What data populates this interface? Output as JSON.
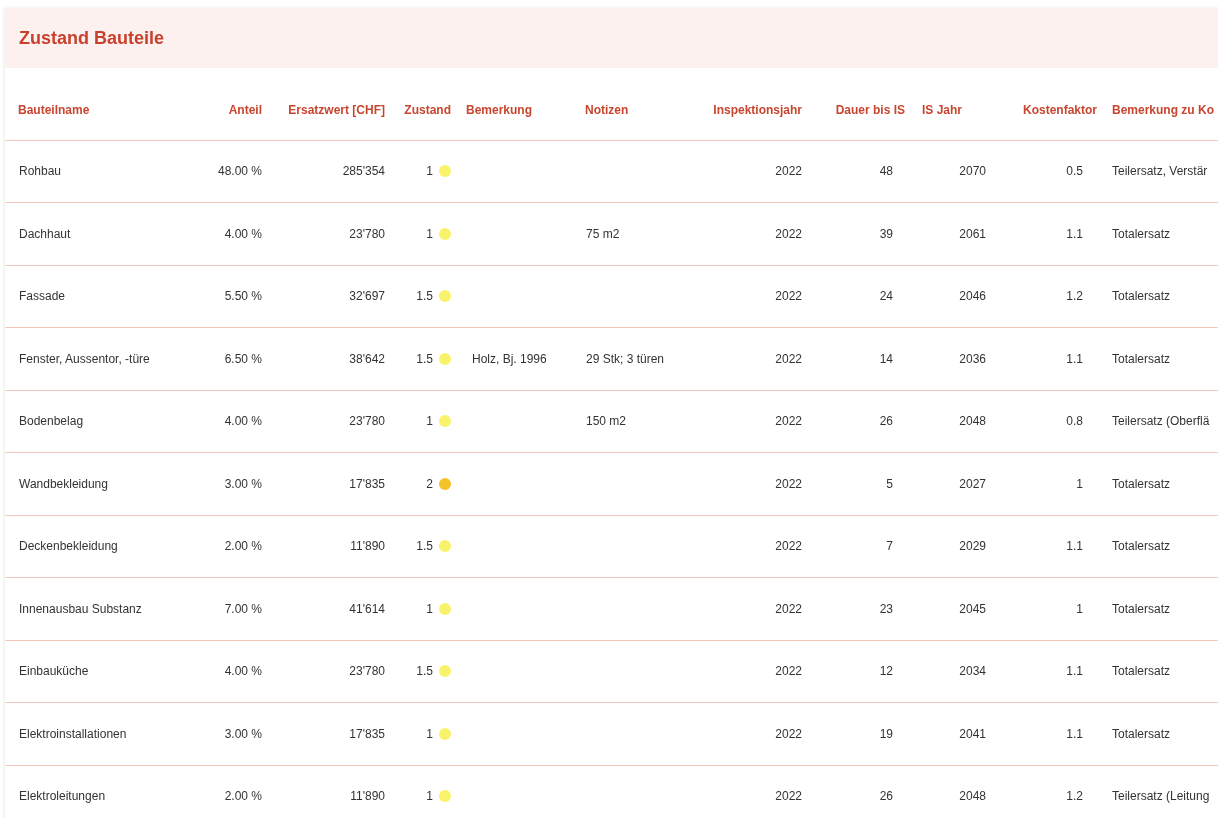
{
  "title": "Zustand Bauteile",
  "table": {
    "columns": [
      "Bauteilname",
      "Anteil",
      "Ersatzwert [CHF]",
      "Zustand",
      "Bemerkung",
      "Notizen",
      "Inspektionsjahr",
      "Dauer bis IS",
      "IS Jahr",
      "Kostenfaktor",
      "Bemerkung zu Ko"
    ],
    "rows": [
      {
        "name": "Rohbau",
        "anteil": "48.00 %",
        "ersatzwert": "285'354",
        "zustand": "1",
        "color": "#f9f36b",
        "bemerkung": "",
        "notizen": "",
        "inspektionsjahr": "2022",
        "dauer": "48",
        "is_jahr": "2070",
        "kostenfaktor": "0.5",
        "bemerkung_kosten": "Teilersatz, Verstär"
      },
      {
        "name": "Dachhaut",
        "anteil": "4.00 %",
        "ersatzwert": "23'780",
        "zustand": "1",
        "color": "#f9f36b",
        "bemerkung": "",
        "notizen": "75 m2",
        "inspektionsjahr": "2022",
        "dauer": "39",
        "is_jahr": "2061",
        "kostenfaktor": "1.1",
        "bemerkung_kosten": "Totalersatz"
      },
      {
        "name": "Fassade",
        "anteil": "5.50 %",
        "ersatzwert": "32'697",
        "zustand": "1.5",
        "color": "#f9f36b",
        "bemerkung": "",
        "notizen": "",
        "inspektionsjahr": "2022",
        "dauer": "24",
        "is_jahr": "2046",
        "kostenfaktor": "1.2",
        "bemerkung_kosten": "Totalersatz"
      },
      {
        "name": "Fenster, Aussentor, -türe",
        "anteil": "6.50 %",
        "ersatzwert": "38'642",
        "zustand": "1.5",
        "color": "#f9f36b",
        "bemerkung": "Holz, Bj. 1996",
        "notizen": "29 Stk; 3 türen",
        "inspektionsjahr": "2022",
        "dauer": "14",
        "is_jahr": "2036",
        "kostenfaktor": "1.1",
        "bemerkung_kosten": "Totalersatz"
      },
      {
        "name": "Bodenbelag",
        "anteil": "4.00 %",
        "ersatzwert": "23'780",
        "zustand": "1",
        "color": "#f9f36b",
        "bemerkung": "",
        "notizen": "150 m2",
        "inspektionsjahr": "2022",
        "dauer": "26",
        "is_jahr": "2048",
        "kostenfaktor": "0.8",
        "bemerkung_kosten": "Teilersatz (Oberflä"
      },
      {
        "name": "Wandbekleidung",
        "anteil": "3.00 %",
        "ersatzwert": "17'835",
        "zustand": "2",
        "color": "#f6c22a",
        "bemerkung": "",
        "notizen": "",
        "inspektionsjahr": "2022",
        "dauer": "5",
        "is_jahr": "2027",
        "kostenfaktor": "1",
        "bemerkung_kosten": "Totalersatz"
      },
      {
        "name": "Deckenbekleidung",
        "anteil": "2.00 %",
        "ersatzwert": "11'890",
        "zustand": "1.5",
        "color": "#f9f36b",
        "bemerkung": "",
        "notizen": "",
        "inspektionsjahr": "2022",
        "dauer": "7",
        "is_jahr": "2029",
        "kostenfaktor": "1.1",
        "bemerkung_kosten": "Totalersatz"
      },
      {
        "name": "Innenausbau Substanz",
        "anteil": "7.00 %",
        "ersatzwert": "41'614",
        "zustand": "1",
        "color": "#f9f36b",
        "bemerkung": "",
        "notizen": "",
        "inspektionsjahr": "2022",
        "dauer": "23",
        "is_jahr": "2045",
        "kostenfaktor": "1",
        "bemerkung_kosten": "Totalersatz"
      },
      {
        "name": "Einbauküche",
        "anteil": "4.00 %",
        "ersatzwert": "23'780",
        "zustand": "1.5",
        "color": "#f9f36b",
        "bemerkung": "",
        "notizen": "",
        "inspektionsjahr": "2022",
        "dauer": "12",
        "is_jahr": "2034",
        "kostenfaktor": "1.1",
        "bemerkung_kosten": "Totalersatz"
      },
      {
        "name": "Elektroinstallationen",
        "anteil": "3.00 %",
        "ersatzwert": "17'835",
        "zustand": "1",
        "color": "#f9f36b",
        "bemerkung": "",
        "notizen": "",
        "inspektionsjahr": "2022",
        "dauer": "19",
        "is_jahr": "2041",
        "kostenfaktor": "1.1",
        "bemerkung_kosten": "Totalersatz"
      },
      {
        "name": "Elektroleitungen",
        "anteil": "2.00 %",
        "ersatzwert": "11'890",
        "zustand": "1",
        "color": "#f9f36b",
        "bemerkung": "",
        "notizen": "",
        "inspektionsjahr": "2022",
        "dauer": "26",
        "is_jahr": "2048",
        "kostenfaktor": "1.2",
        "bemerkung_kosten": "Teilersatz (Leitung"
      }
    ]
  }
}
